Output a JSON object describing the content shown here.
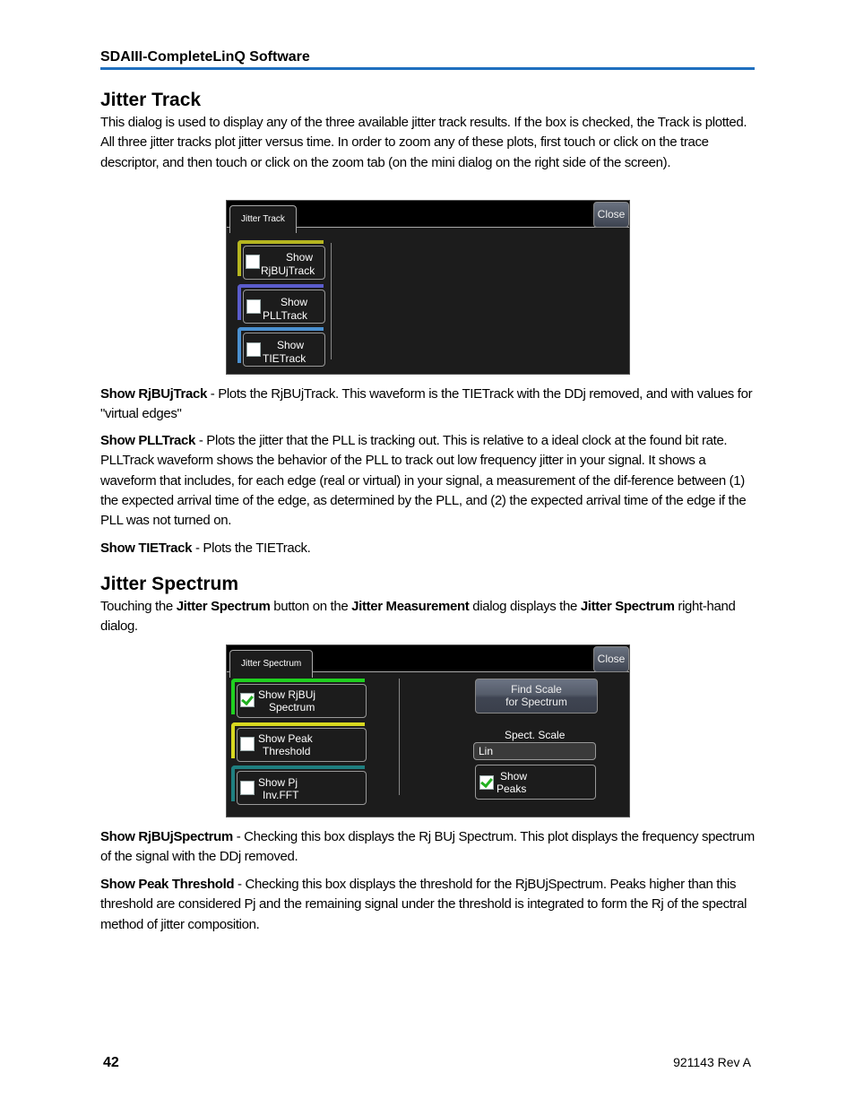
{
  "header": {
    "title": "SDAIII-CompleteLinQ Software",
    "rule_color": "#1f6fbf"
  },
  "jitter_track": {
    "heading": "Jitter Track",
    "intro": "This dialog is used to display any of the three available jitter track results. If the box is checked, the Track is plotted. All three jitter tracks plot jitter versus time. In order to zoom any of these plots, first touch or click on the trace descriptor, and then touch or click on the zoom tab (on the mini dialog on the right side of the screen).",
    "dialog": {
      "tab_label": "Jitter Track",
      "close_label": "Close",
      "items": [
        {
          "line1": "Show",
          "line2": "RjBUjTrack",
          "checked": false,
          "color": "#b5b520"
        },
        {
          "line1": "Show",
          "line2": "PLLTrack",
          "checked": false,
          "color": "#5a5ccc"
        },
        {
          "line1": "Show",
          "line2": "TIETrack",
          "checked": false,
          "color": "#4a90d0"
        }
      ]
    },
    "descriptions": [
      {
        "term": "Show RjBUjTrack",
        "text": " - Plots the RjBUjTrack. This waveform is the TIETrack with the DDj removed, and with values for \"virtual edges\""
      },
      {
        "term": "Show PLLTrack",
        "text": " - Plots the jitter that the PLL is tracking out. This is relative to a ideal clock at the found bit rate. PLLTrack waveform shows the behavior of the PLL to track out low frequency jitter in your signal. It shows a waveform that includes, for each edge (real or virtual) in your signal, a measurement of the dif-ference between (1) the expected arrival time of the edge, as determined by the PLL, and (2) the expected arrival time of the edge if the PLL was not turned on."
      },
      {
        "term": "Show TIETrack",
        "text": " - Plots the TIETrack."
      }
    ]
  },
  "jitter_spectrum": {
    "heading": "Jitter Spectrum",
    "intro": {
      "p1": "Touching the ",
      "b1": "Jitter Spectrum",
      "p2": " button on the ",
      "b2": "Jitter Measurement",
      "p3": " dialog displays the ",
      "b3": "Jitter Spectrum",
      "p4": " right-hand dialog."
    },
    "dialog": {
      "tab_label": "Jitter Spectrum",
      "close_label": "Close",
      "items": [
        {
          "line1": "Show RjBUj",
          "line2": "Spectrum",
          "checked": true,
          "color": "#20d020"
        },
        {
          "line1": "Show Peak",
          "line2": "Threshold",
          "checked": false,
          "color": "#d8d820"
        },
        {
          "line1": "Show Pj",
          "line2": "Inv.FFT",
          "checked": false,
          "color": "#1f7f80"
        }
      ],
      "find_scale": {
        "line1": "Find Scale",
        "line2": "for Spectrum"
      },
      "spect_scale": {
        "label": "Spect. Scale",
        "value": "Lin"
      },
      "show_peaks": {
        "line1": "Show",
        "line2": "Peaks",
        "checked": true
      }
    },
    "descriptions": [
      {
        "term": "Show RjBUjSpectrum",
        "text": " - Checking this box displays the Rj BUj Spectrum. This plot displays the frequency spectrum of the signal with the DDj removed."
      },
      {
        "term": "Show Peak Threshold",
        "text": " - Checking this box displays the threshold for the RjBUjSpectrum. Peaks higher than this threshold are considered Pj and the remaining signal under the threshold is integrated to form the Rj of the spectral method of jitter composition."
      }
    ]
  },
  "footer": {
    "page_number": "42",
    "doc_rev": "921143 Rev A"
  }
}
